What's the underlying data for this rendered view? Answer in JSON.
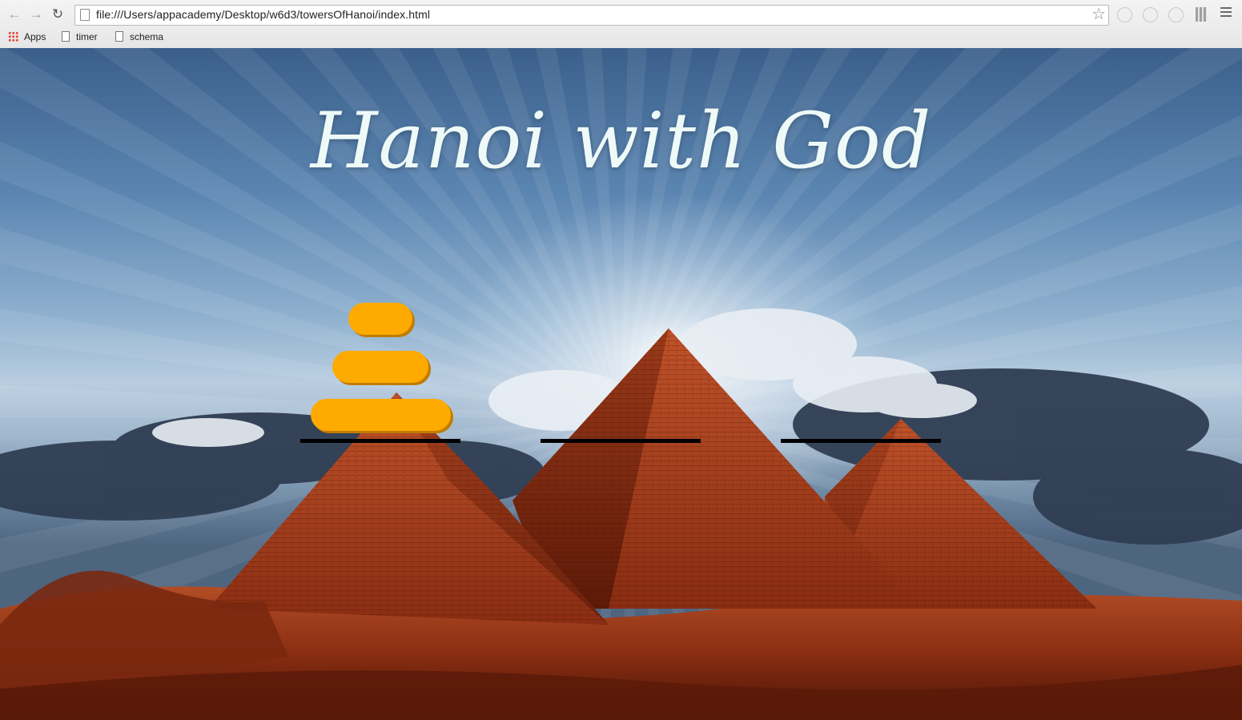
{
  "browser": {
    "url": "file:///Users/appacademy/Desktop/w6d3/towersOfHanoi/index.html",
    "bookmarks": [
      {
        "label": "Apps",
        "icon": "apps-grid-icon"
      },
      {
        "label": "timer",
        "icon": "page-icon"
      },
      {
        "label": "schema",
        "icon": "page-icon"
      }
    ]
  },
  "page": {
    "title": "Hanoi with God",
    "colors": {
      "disc": "#ffaa00",
      "rod": "#000000",
      "title": "#eefaf8"
    }
  },
  "game": {
    "towers": [
      {
        "discs": [
          1,
          2,
          3
        ]
      },
      {
        "discs": []
      },
      {
        "discs": []
      }
    ]
  }
}
